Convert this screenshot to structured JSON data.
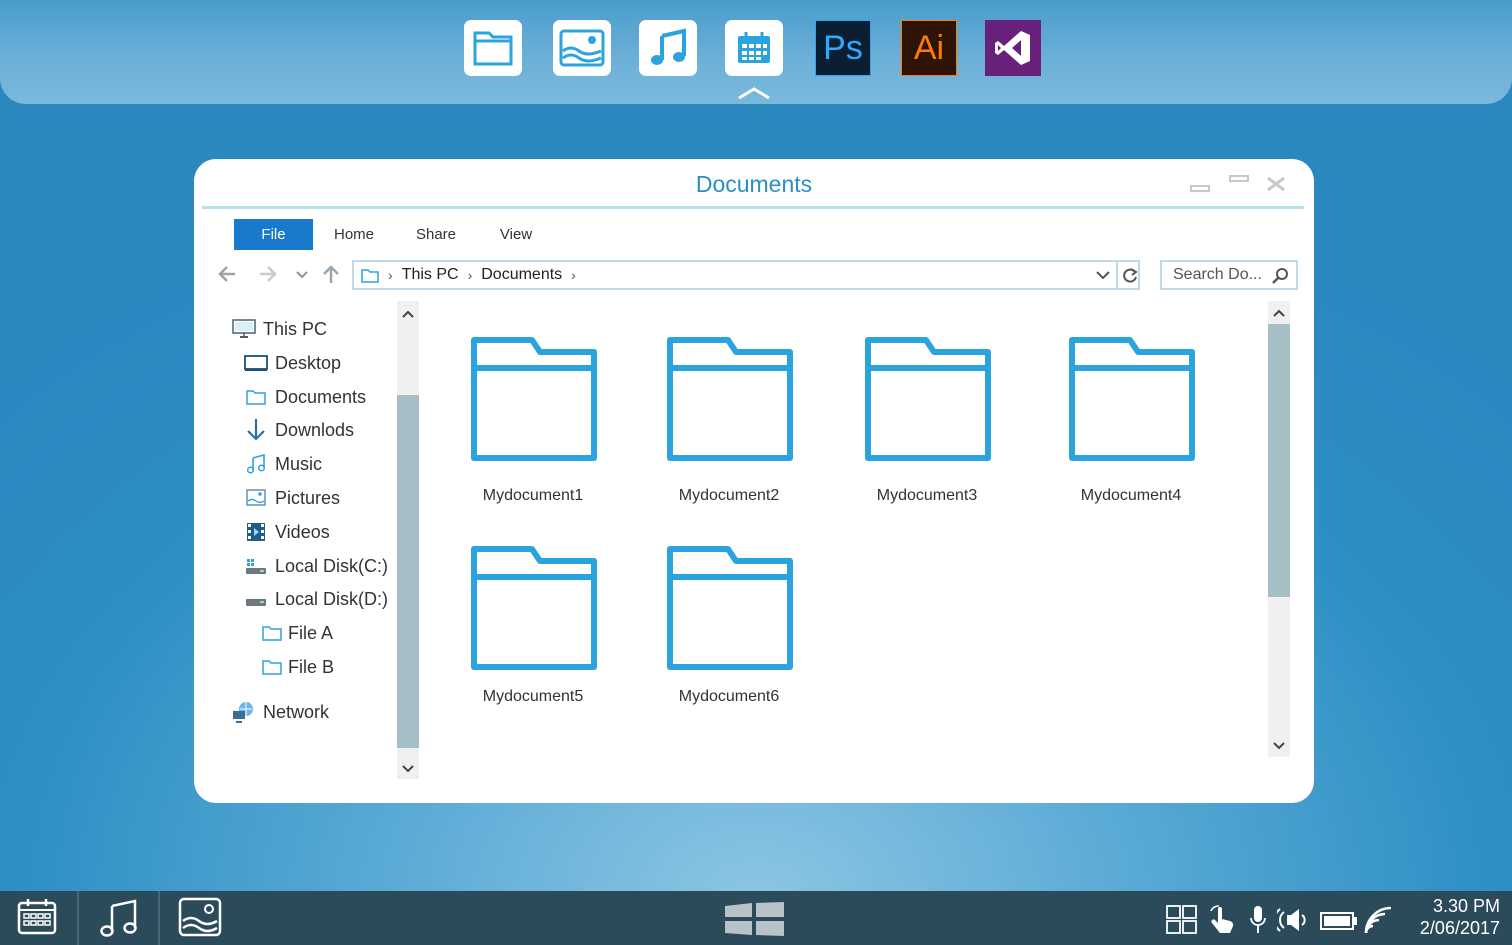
{
  "dock": {
    "apps": [
      "files",
      "photos",
      "music",
      "calendar",
      "photoshop",
      "illustrator",
      "visual-studio"
    ],
    "ps_label": "Ps",
    "ai_label": "Ai"
  },
  "window": {
    "title": "Documents"
  },
  "ribbon": {
    "tabs": [
      "File",
      "Home",
      "Share",
      "View"
    ]
  },
  "address": {
    "segments": [
      "This PC",
      "Documents"
    ]
  },
  "search": {
    "placeholder": "Search Do..."
  },
  "nav_tree": {
    "this_pc": "This PC",
    "items": [
      "Desktop",
      "Documents",
      "Downlods",
      "Music",
      "Pictures",
      "Videos",
      "Local Disk(C:)",
      "Local Disk(D:)"
    ],
    "sub_items": [
      "File A",
      "File B"
    ],
    "network": "Network"
  },
  "folders": [
    "Mydocument1",
    "Mydocument2",
    "Mydocument3",
    "Mydocument4",
    "Mydocument5",
    "Mydocument6"
  ],
  "taskbar": {
    "time": "3.30 PM",
    "date": "2/06/2017"
  },
  "colors": {
    "accent": "#2aa3df",
    "title": "#2a8fc4",
    "ribbon_active": "#1979ca",
    "taskbar": "#2b4b5b"
  }
}
